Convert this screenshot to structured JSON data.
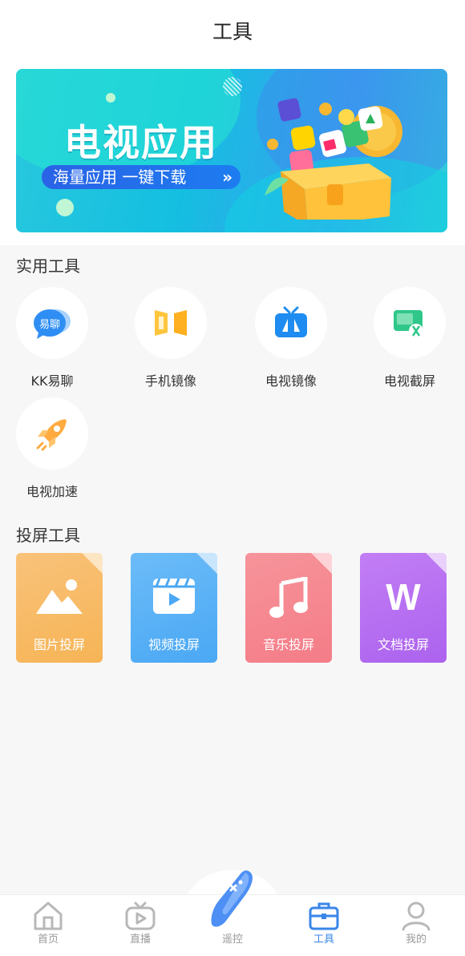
{
  "page": {
    "title": "工具"
  },
  "banner": {
    "title": "电视应用",
    "subtitle": "海量应用 一键下载",
    "chevron": "»"
  },
  "practical": {
    "title": "实用工具",
    "items": [
      {
        "label": "KK易聊",
        "icon": "kk-chat-icon",
        "badge": "易聊"
      },
      {
        "label": "手机镜像",
        "icon": "phone-mirror-icon"
      },
      {
        "label": "电视镜像",
        "icon": "tv-mirror-icon"
      },
      {
        "label": "电视截屏",
        "icon": "tv-screenshot-icon"
      },
      {
        "label": "电视加速",
        "icon": "rocket-icon"
      }
    ]
  },
  "cast": {
    "title": "投屏工具",
    "items": [
      {
        "label": "图片投屏",
        "icon": "image-icon",
        "color": "#f7b55d"
      },
      {
        "label": "视频投屏",
        "icon": "video-icon",
        "color": "#55aef5"
      },
      {
        "label": "音乐投屏",
        "icon": "music-icon",
        "color": "#f4838d"
      },
      {
        "label": "文档投屏",
        "icon": "word-doc-icon",
        "color": "#b46df2",
        "glyph": "W"
      }
    ]
  },
  "tabbar": {
    "items": [
      {
        "label": "首页",
        "icon": "home-icon"
      },
      {
        "label": "直播",
        "icon": "live-tv-icon"
      },
      {
        "label": "遥控",
        "icon": "remote-icon"
      },
      {
        "label": "工具",
        "icon": "toolbox-icon",
        "active": true
      },
      {
        "label": "我的",
        "icon": "user-icon"
      }
    ],
    "accent": "#3a86e8"
  }
}
